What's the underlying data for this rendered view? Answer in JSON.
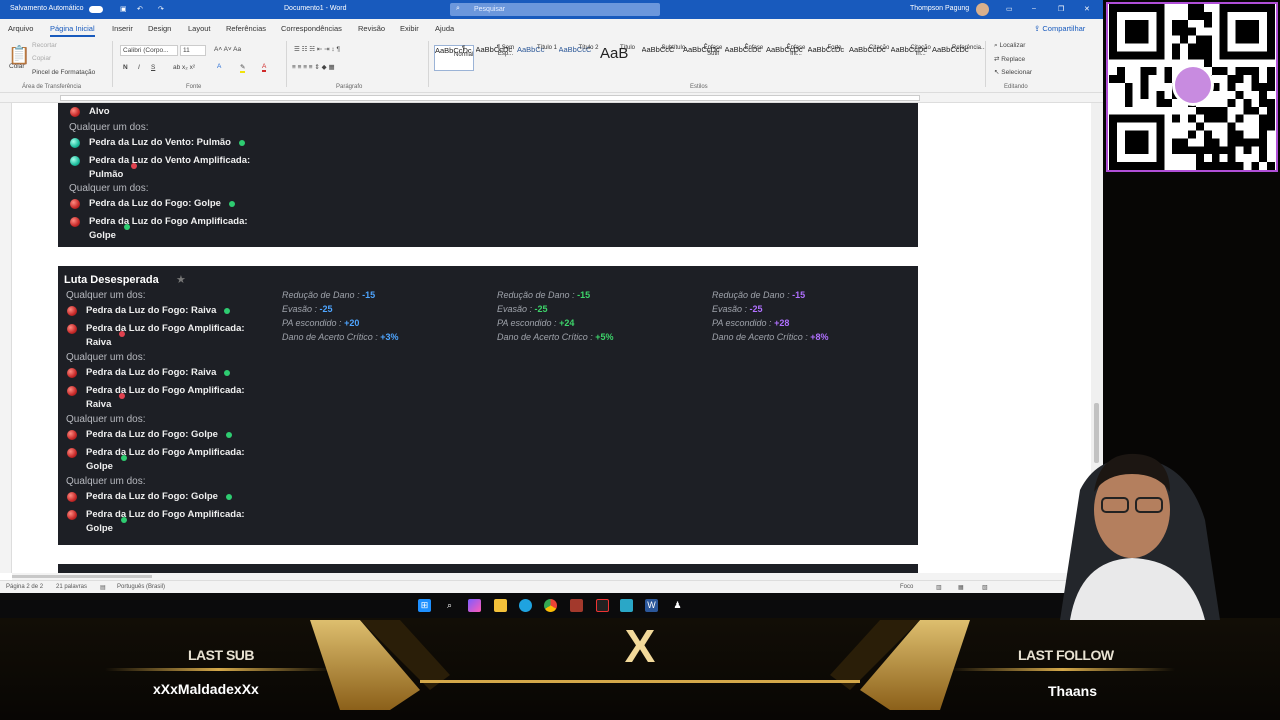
{
  "titlebar": {
    "autosave_label": "Salvamento Automático",
    "doc_title": "Documento1 - Word",
    "search_placeholder": "Pesquisar",
    "user": "Thompson Pagung"
  },
  "menu": {
    "items": [
      "Arquivo",
      "Página Inicial",
      "Inserir",
      "Design",
      "Layout",
      "Referências",
      "Correspondências",
      "Revisão",
      "Exibir",
      "Ajuda"
    ],
    "share": "Compartilhar"
  },
  "ribbon": {
    "clipboard": {
      "paste": "Colar",
      "cut": "Recortar",
      "copy": "Copiar",
      "format_painter": "Pincel de Formatação",
      "group": "Área de Transferência"
    },
    "font": {
      "name": "Calibri (Corpo...",
      "size": "11",
      "group": "Fonte"
    },
    "paragraph": {
      "group": "Parágrafo"
    },
    "styles": {
      "group": "Estilos",
      "items": [
        {
          "sample": "AaBbCcDc",
          "label": "¶ Normal"
        },
        {
          "sample": "AaBbCcDc",
          "label": "¶ Sem Esp..."
        },
        {
          "sample": "AaBbCc",
          "label": "Título 1"
        },
        {
          "sample": "AaBbCcC",
          "label": "Título 2"
        },
        {
          "sample": "AaB",
          "label": "Título"
        },
        {
          "sample": "AaBbCcC",
          "label": "Subtítulo"
        },
        {
          "sample": "AaBbCcDc",
          "label": "Ênfase Sutil"
        },
        {
          "sample": "AaBbCcDc",
          "label": "Ênfase"
        },
        {
          "sample": "AaBbCcDc",
          "label": "Ênfase Int..."
        },
        {
          "sample": "AaBbCcDc",
          "label": "Forte"
        },
        {
          "sample": "AaBbCcDc",
          "label": "Citação"
        },
        {
          "sample": "AaBbCcDc",
          "label": "Citação In..."
        },
        {
          "sample": "AaBbCcDc",
          "label": "Referência..."
        }
      ]
    },
    "editing": {
      "find": "Localizar",
      "replace": "Replace",
      "select": "Selecionar",
      "group": "Editando"
    }
  },
  "card1": {
    "rows": [
      {
        "kind": "item",
        "gem": "red",
        "text": "Alvo"
      },
      {
        "kind": "hdr",
        "text": "Qualquer um dos:"
      },
      {
        "kind": "item",
        "gem": "teal",
        "text": "Pedra da Luz do Vento: Pulmão",
        "dot": "g"
      },
      {
        "kind": "item",
        "gem": "teal",
        "text": "Pedra da Luz do Vento Amplificada:",
        "text2": "Pulmão",
        "dot": "r"
      },
      {
        "kind": "hdr",
        "text": "Qualquer um dos:"
      },
      {
        "kind": "item",
        "gem": "red",
        "text": "Pedra da Luz do Fogo: Golpe",
        "dot": "g"
      },
      {
        "kind": "item",
        "gem": "red",
        "text": "Pedra da Luz do Fogo Amplificada:",
        "text2": "Golpe",
        "dot": "g"
      }
    ]
  },
  "card2": {
    "title": "Luta Desesperada",
    "rows": [
      {
        "hdr": "Qualquer um dos:"
      },
      {
        "gem": "red",
        "text": "Pedra da Luz do Fogo: Raiva",
        "dot": "g"
      },
      {
        "gem": "red",
        "text": "Pedra da Luz do Fogo Amplificada:",
        "text2": "Raiva",
        "dot": "r"
      },
      {
        "hdr": "Qualquer um dos:"
      },
      {
        "gem": "red",
        "text": "Pedra da Luz do Fogo: Raiva",
        "dot": "g"
      },
      {
        "gem": "red",
        "text": "Pedra da Luz do Fogo Amplificada:",
        "text2": "Raiva",
        "dot": "r"
      },
      {
        "hdr": "Qualquer um dos:"
      },
      {
        "gem": "red",
        "text": "Pedra da Luz do Fogo: Golpe",
        "dot": "g"
      },
      {
        "gem": "red",
        "text": "Pedra da Luz do Fogo Amplificada:",
        "text2": "Golpe",
        "dot": "g"
      },
      {
        "hdr": "Qualquer um dos:"
      },
      {
        "gem": "red",
        "text": "Pedra da Luz do Fogo: Golpe",
        "dot": "g"
      },
      {
        "gem": "red",
        "text": "Pedra da Luz do Fogo Amplificada:",
        "text2": "Golpe",
        "dot": "g"
      }
    ],
    "columns": [
      {
        "color": "#4ea5ff",
        "stats": [
          {
            "label": "Redução de Dano",
            "value": "-15"
          },
          {
            "label": "Evasão",
            "value": "-25"
          },
          {
            "label": "PA escondido",
            "value": "+20"
          },
          {
            "label": "Dano de Acerto Crítico",
            "value": "+3%"
          }
        ]
      },
      {
        "color": "#3dd46a",
        "stats": [
          {
            "label": "Redução de Dano",
            "value": "-15"
          },
          {
            "label": "Evasão",
            "value": "-25"
          },
          {
            "label": "PA escondido",
            "value": "+24"
          },
          {
            "label": "Dano de Acerto Crítico",
            "value": "+5%"
          }
        ]
      },
      {
        "color": "#b070ff",
        "stats": [
          {
            "label": "Redução de Dano",
            "value": "-15"
          },
          {
            "label": "Evasão",
            "value": "-25"
          },
          {
            "label": "PA escondido",
            "value": "+28"
          },
          {
            "label": "Dano de Acerto Crítico",
            "value": "+8%"
          }
        ]
      }
    ]
  },
  "status": {
    "page": "Página 2 de 2",
    "words": "21 palavras",
    "lang": "Português (Brasil)",
    "focus": "Foco"
  },
  "overlay": {
    "last_sub_label": "LAST SUB",
    "last_sub_name": "xXxMaldadexXx",
    "last_follow_label": "LAST FOLLOW",
    "last_follow_name": "Thaans"
  }
}
